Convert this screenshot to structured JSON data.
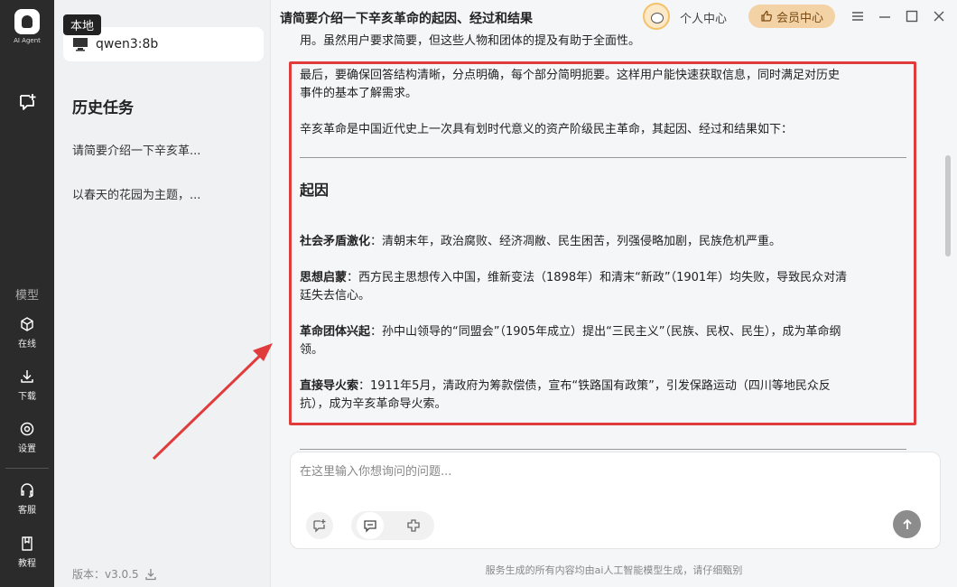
{
  "app": {
    "logo_text": "AI Agent",
    "badge": "本地"
  },
  "rail": {
    "model_section": "模型",
    "items": [
      {
        "label": "在线",
        "icon": "cube-icon"
      },
      {
        "label": "下载",
        "icon": "download-icon"
      },
      {
        "label": "设置",
        "icon": "gear-icon"
      },
      {
        "label": "客服",
        "icon": "headset-icon"
      },
      {
        "label": "教程",
        "icon": "book-icon"
      }
    ]
  },
  "sidebar": {
    "model_name": "qwen3:8b",
    "history_title": "历史任务",
    "history": [
      "请简要介绍一下辛亥革...",
      "以春天的花园为主题，..."
    ],
    "version": "版本：v3.0.5"
  },
  "header": {
    "title": "请简要介绍一下辛亥革命的起因、经过和结果",
    "personal_center": "个人中心",
    "vip_center": "会员中心"
  },
  "chat": {
    "p_top": "用。虽然用户要求简要，但这些人物和团体的提及有助于全面性。",
    "p_final_line1": "最后，要确保回答结构清晰，分点明确，每个部分简明扼要。这样用户能快速获取信息，同时满足对历史",
    "p_final_line2": "事件的基本了解需求。",
    "p_intro": "辛亥革命是中国近代史上一次具有划时代意义的资产阶级民主革命，其起因、经过和结果如下：",
    "section_title": "起因",
    "points": [
      {
        "label": "社会矛盾激化",
        "text": "：清朝末年，政治腐败、经济凋敝、民生困苦，列强侵略加剧，民族危机严重。",
        "text2": ""
      },
      {
        "label": "思想启蒙",
        "text": "：西方民主思想传入中国，维新变法（1898年）和清末“新政”（1901年）均失败，导致民众对清",
        "text2": "廷失去信心。"
      },
      {
        "label": "革命团体兴起",
        "text": "：孙中山领导的“同盟会”（1905年成立）提出“三民主义”（民族、民权、民生），成为革命纲",
        "text2": "领。"
      },
      {
        "label": "直接导火索",
        "text": "：1911年5月，清政府为筹款偿债，宣布“铁路国有政策”，引发保路运动（四川等地民众反",
        "text2": "抗），成为辛亥革命导火索。"
      }
    ]
  },
  "input": {
    "placeholder": "在这里输入你想询问的问题...",
    "value": ""
  },
  "footer": {
    "note": "服务生成的所有内容均由ai人工智能模型生成，请仔细甄别"
  },
  "colors": {
    "highlight": "#e03c3c",
    "vip": "#f3d3a6",
    "rail": "#2b2b2b"
  }
}
